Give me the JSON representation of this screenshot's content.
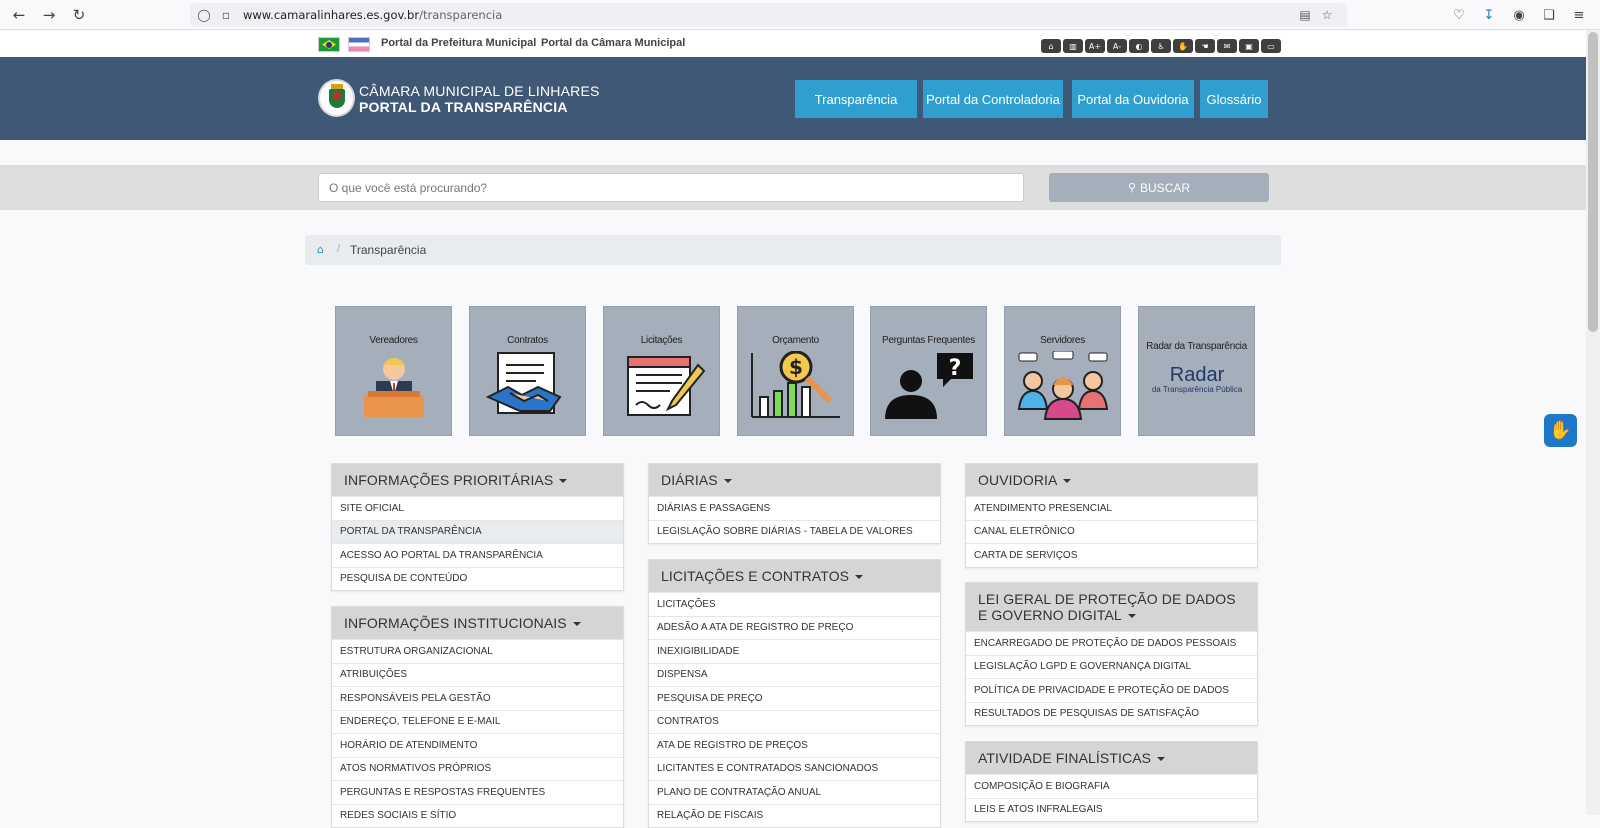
{
  "browser": {
    "url_host": "www.camaralinhares.es.gov.br",
    "url_path": "/transparencia"
  },
  "util_links": {
    "prefeitura": "Portal da Prefeitura Municipal",
    "camara": "Portal da Câmara Municipal"
  },
  "accessibility_icons": [
    "home-icon",
    "map-icon",
    "font-increase-icon",
    "font-decrease-icon",
    "contrast-icon",
    "wheelchair-icon",
    "sign-language-icon",
    "hand-icon",
    "envelope-icon",
    "lock-icon",
    "laptop-icon"
  ],
  "header": {
    "title_line1": "CÂMARA MUNICIPAL DE LINHARES",
    "title_line2": "PORTAL DA TRANSPARÊNCIA",
    "nav": [
      "Transparência",
      "Portal da Controladoria",
      "Portal da Ouvidoria",
      "Glossário"
    ]
  },
  "search": {
    "placeholder": "O que você está procurando?",
    "button": "BUSCAR"
  },
  "breadcrumb": {
    "current": "Transparência"
  },
  "tiles": [
    {
      "label": "Vereadores",
      "icon": "councilor-icon"
    },
    {
      "label": "Contratos",
      "icon": "handshake-contract-icon"
    },
    {
      "label": "Licitações",
      "icon": "document-pen-icon"
    },
    {
      "label": "Orçamento",
      "icon": "money-chart-icon"
    },
    {
      "label": "Perguntas Frequentes",
      "icon": "question-person-icon"
    },
    {
      "label": "Servidores",
      "icon": "people-chat-icon"
    },
    {
      "label": "Radar da Transparência",
      "icon": "radar-logo",
      "logo_text": "Radar",
      "logo_sub": "da Transparência Pública"
    }
  ],
  "panels": {
    "prioritarias": {
      "title": "INFORMAÇÕES PRIORITÁRIAS",
      "items": [
        "SITE OFICIAL",
        "PORTAL DA TRANSPARÊNCIA",
        "ACESSO AO PORTAL DA TRANSPARÊNCIA",
        "PESQUISA DE CONTEÚDO"
      ]
    },
    "institucionais": {
      "title": "INFORMAÇÕES INSTITUCIONAIS",
      "items": [
        "ESTRUTURA ORGANIZACIONAL",
        "ATRIBUIÇÕES",
        "RESPONSÁVEIS PELA GESTÃO",
        "ENDEREÇO, TELEFONE E E-MAIL",
        "HORÁRIO DE ATENDIMENTO",
        "ATOS NORMATIVOS PRÓPRIOS",
        "PERGUNTAS E RESPOSTAS FREQUENTES",
        "REDES SOCIAIS E SÍTIO"
      ]
    },
    "diarias": {
      "title": "DIÁRIAS",
      "items": [
        "DIÁRIAS E PASSAGENS",
        "LEGISLAÇÃO SOBRE DIÁRIAS - TABELA DE VALORES"
      ]
    },
    "licitacoes": {
      "title": "LICITAÇÕES E CONTRATOS",
      "items": [
        "LICITAÇÕES",
        "ADESÃO A ATA DE REGISTRO DE PREÇO",
        "INEXIGIBILIDADE",
        "DISPENSA",
        "PESQUISA DE PREÇO",
        "CONTRATOS",
        "ATA DE REGISTRO DE PREÇOS",
        "LICITANTES E CONTRATADOS SANCIONADOS",
        "PLANO DE CONTRATAÇÃO ANUAL",
        "RELAÇÃO DE FISCAIS"
      ]
    },
    "ouvidoria": {
      "title": "OUVIDORIA",
      "items": [
        "ATENDIMENTO PRESENCIAL",
        "CANAL ELETRÔNICO",
        "CARTA DE SERVIÇOS"
      ]
    },
    "lgpd": {
      "title": "LEI GERAL DE PROTEÇÃO DE DADOS E GOVERNO DIGITAL",
      "items": [
        "ENCARREGADO DE PROTEÇÃO DE DADOS PESSOAIS",
        "LEGISLAÇÃO LGPD E GOVERNANÇA DIGITAL",
        "POLÍTICA DE PRIVACIDADE E PROTEÇÃO DE DADOS",
        "RESULTADOS DE PESQUISAS DE SATISFAÇÃO"
      ]
    },
    "atividade": {
      "title": "ATIVIDADE FINALÍSTICAS",
      "items": [
        "COMPOSIÇÃO E BIOGRAFIA",
        "LEIS E ATOS INFRALEGAIS"
      ]
    }
  },
  "colors": {
    "header_bg": "#3f5876",
    "nav_bg": "#2f9fd0",
    "tile_bg": "#a5aebb",
    "panel_head_bg": "#d5d5d5"
  }
}
